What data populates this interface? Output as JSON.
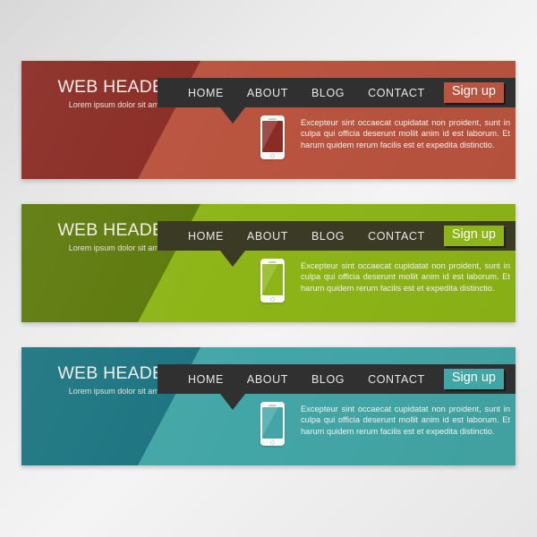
{
  "page": {
    "background_top": "#d8d8d8",
    "background_bottom": "#e6e6e6"
  },
  "banners": [
    {
      "id": "banner-red",
      "brand_title": "WEB HEADER",
      "brand_subtitle": "Lorem ipsum dolor sit amet",
      "nav": [
        "HOME",
        "ABOUT",
        "BLOG",
        "CONTACT"
      ],
      "signup_label": "Sign up",
      "body_text": "Excepteur sint occaecat cupidatat non proident, sunt in culpa qui officia deserunt mollit anim id est laborum. Et harum quidem rerum facilis est et expedita distinctio.",
      "phone_icon": "smartphone-icon",
      "colors": {
        "field": "#b9543f",
        "panel": "#8a2c25",
        "navbar": "#303030",
        "signup_bg": "#b9543f",
        "screen": "#8a2c25"
      }
    },
    {
      "id": "banner-green",
      "brand_title": "WEB HEADER",
      "brand_subtitle": "Lorem ipsum dolor sit amet",
      "nav": [
        "HOME",
        "ABOUT",
        "BLOG",
        "CONTACT"
      ],
      "signup_label": "Sign up",
      "body_text": "Excepteur sint occaecat cupidatat non proident, sunt in culpa qui officia deserunt mollit anim id est laborum. Et harum quidem rerum facilis est et expedita distinctio.",
      "phone_icon": "smartphone-icon",
      "colors": {
        "field": "#8db517",
        "panel": "#5d7a0c",
        "navbar": "#3a3a25",
        "signup_bg": "#8db517",
        "screen": "#8db517"
      }
    },
    {
      "id": "banner-teal",
      "brand_title": "WEB HEADER",
      "brand_subtitle": "Lorem ipsum dolor sit amet",
      "nav": [
        "HOME",
        "ABOUT",
        "BLOG",
        "CONTACT"
      ],
      "signup_label": "Sign up",
      "body_text": "Excepteur sint occaecat cupidatat non proident, sunt in culpa qui officia deserunt mollit anim id est laborum. Et harum quidem rerum facilis est et expedita distinctio.",
      "phone_icon": "smartphone-icon",
      "colors": {
        "field": "#43a6a6",
        "panel": "#1b7480",
        "navbar": "#303030",
        "signup_bg": "#43a6a6",
        "screen": "#43a6a6"
      }
    }
  ]
}
